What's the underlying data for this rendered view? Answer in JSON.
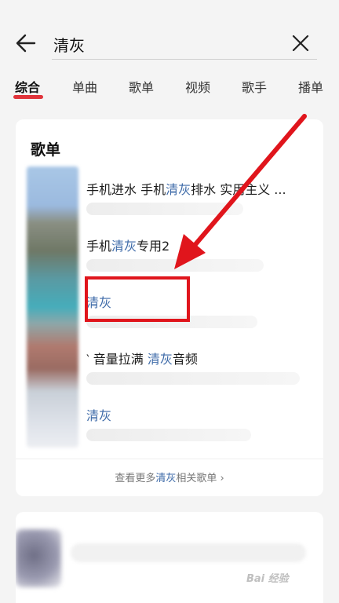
{
  "search": {
    "value": "清灰"
  },
  "tabs": [
    {
      "label": "综合"
    },
    {
      "label": "单曲"
    },
    {
      "label": "歌单"
    },
    {
      "label": "视频"
    },
    {
      "label": "歌手"
    },
    {
      "label": "播单"
    }
  ],
  "playlist_section": {
    "title": "歌单",
    "items": [
      {
        "pre": "手机进水 手机",
        "hl": "清灰",
        "post": "排水 实用主义 ..."
      },
      {
        "pre": "手机",
        "hl": "清灰",
        "post": "专用2"
      },
      {
        "pre": "",
        "hl": "清灰",
        "post": ""
      },
      {
        "pre": "‵ 音量拉满 ",
        "hl": "清灰",
        "post": "音频"
      },
      {
        "pre": "",
        "hl": "清灰",
        "post": ""
      }
    ],
    "more": {
      "pre": "查看更多",
      "hl": "清灰",
      "post": "相关歌单 ›"
    }
  },
  "watermark": "Bai 经验",
  "colors": {
    "highlight": "#3d6aa8",
    "tab_indicator": "#e0343b",
    "annotation_red": "#e0151c"
  }
}
